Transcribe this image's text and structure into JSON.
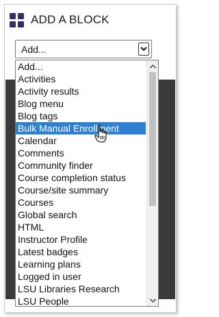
{
  "block": {
    "title": "ADD A BLOCK",
    "icon": "grid-icon",
    "icon_color": "#3b2a6b"
  },
  "select": {
    "value": "Add..."
  },
  "dropdown": {
    "selected_index": 4,
    "selected_color": "#2f80d1",
    "options": [
      "Add...",
      "Activities",
      "Activity results",
      "Blog menu",
      "Blog tags",
      "Bulk Manual Enrollment",
      "Calendar",
      "Comments",
      "Community finder",
      "Course completion status",
      "Course/site summary",
      "Courses",
      "Global search",
      "HTML",
      "Instructor Profile",
      "Latest badges",
      "Learning plans",
      "Logged in user",
      "LSU Libraries Research",
      "LSU People"
    ]
  }
}
